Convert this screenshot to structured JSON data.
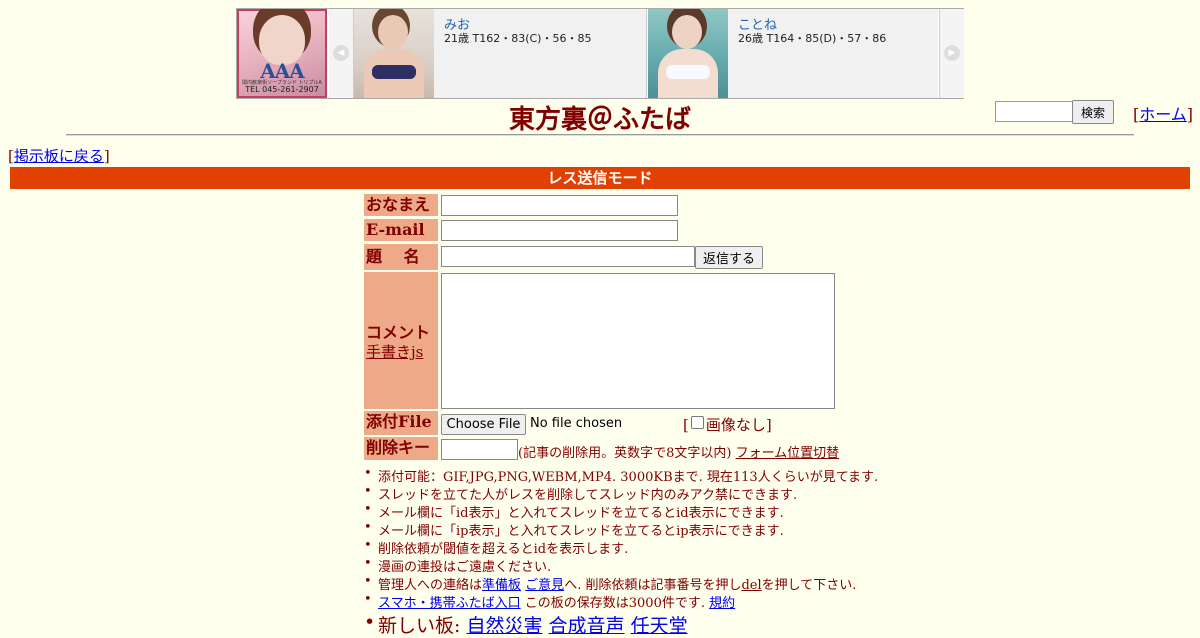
{
  "banner": {
    "ad_brand": "AAA",
    "ad_tagline": "関内歓楽街ソープランド トリプルA",
    "ad_phone": "TEL 045-261-2907",
    "profiles": [
      {
        "name": "みお",
        "stats": "21歳 T162・83(C)・56・85"
      },
      {
        "name": "ことね",
        "stats": "26歳 T164・85(D)・57・86"
      }
    ]
  },
  "header": {
    "site_title": "東方裏＠ふたば",
    "search_button": "検索",
    "home_open": "[",
    "home_link": "ホーム",
    "home_close": "]"
  },
  "nav": {
    "back_open": "[",
    "back_link": "掲示板に戻る",
    "back_close": "]"
  },
  "mode_banner": "レス送信モード",
  "form": {
    "name_label": "おなまえ",
    "email_label": "E-mail",
    "subject_label": "題　 名",
    "reply_button": "返信する",
    "comment_label": "コメント",
    "handwriting_link": "手書きjs",
    "file_label": "添付File",
    "choose_file_button": "Choose File",
    "file_status": "No file chosen",
    "no_image_open": "[",
    "no_image_label": "画像なし]",
    "delkey_label": "削除キー",
    "delkey_note": "(記事の削除用。英数字で8文字以内)",
    "form_toggle_link": "フォーム位置切替"
  },
  "notes": {
    "n1": "添付可能：GIF,JPG,PNG,WEBM,MP4. 3000KBまで. 現在113人くらいが見てます.",
    "n2": "スレッドを立てた人がレスを削除してスレッド内のみアク禁にできます.",
    "n3": "メール欄に「id表示」と入れてスレッドを立てるとid表示にできます.",
    "n4": "メール欄に「ip表示」と入れてスレッドを立てるとip表示にできます.",
    "n5": "削除依頼が閾値を超えるとidを表示します.",
    "n6": "漫画の連投はご遠慮ください.",
    "n7_prefix": "管理人への連絡は",
    "n7_link1": "準備板",
    "n7_link2": "ご意見",
    "n7_mid": "へ. 削除依頼は記事番号を押し",
    "n7_link3": "del",
    "n7_suffix": "を押して下さい.",
    "n8_link": "スマホ・携帯ふたば入口",
    "n8_mid": " この板の保存数は3000件です. ",
    "n8_rules": "規約",
    "n9_prefix": "新しい板: ",
    "n9_links": [
      "自然災害",
      "合成音声",
      "任天堂"
    ]
  },
  "colors": {
    "background": "#ffffee",
    "text": "#800000",
    "label_bg": "#eeaa88",
    "banner_bg": "#e04000",
    "link": "#0000ee"
  }
}
